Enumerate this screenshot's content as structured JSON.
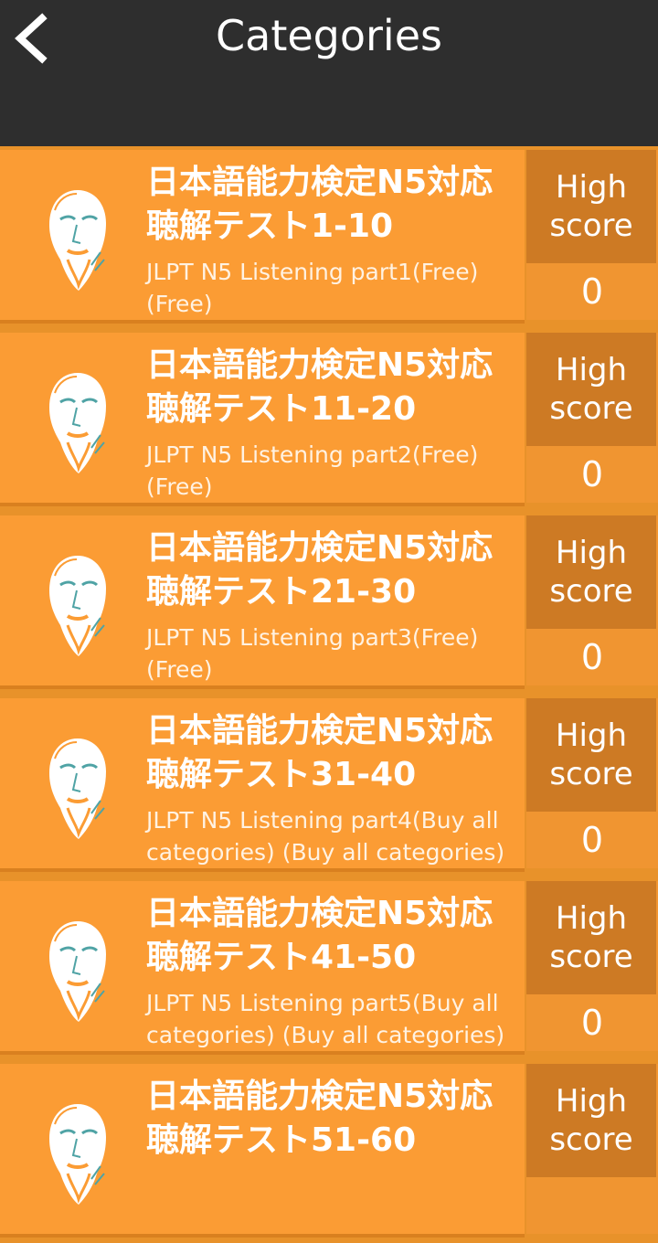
{
  "header": {
    "title": "Categories",
    "back_icon": "chevron-left-icon"
  },
  "colors": {
    "header_bg": "#2e2e2e",
    "card_bg": "#fb9c34",
    "score_label_bg": "#cd7a24",
    "text": "#ffffff"
  },
  "categories": [
    {
      "title": "日本語能力検定N5対応聴解テスト1-10",
      "subtitle": "JLPT N5 Listening part1(Free) (Free)",
      "score_label": "High score",
      "score": "0"
    },
    {
      "title": "日本語能力検定N5対応聴解テスト11-20",
      "subtitle": "JLPT N5 Listening part2(Free) (Free)",
      "score_label": "High score",
      "score": "0"
    },
    {
      "title": "日本語能力検定N5対応聴解テスト21-30",
      "subtitle": "JLPT N5 Listening part3(Free) (Free)",
      "score_label": "High score",
      "score": "0"
    },
    {
      "title": "日本語能力検定N5対応聴解テスト31-40",
      "subtitle": "JLPT N5 Listening part4(Buy all categories) (Buy all categories)",
      "score_label": "High score",
      "score": "0"
    },
    {
      "title": "日本語能力検定N5対応聴解テスト41-50",
      "subtitle": "JLPT N5 Listening part5(Buy all categories) (Buy all categories)",
      "score_label": "High score",
      "score": "0"
    },
    {
      "title": "日本語能力検定N5対応聴解テスト51-60",
      "subtitle": "",
      "score_label": "High score",
      "score": ""
    }
  ]
}
